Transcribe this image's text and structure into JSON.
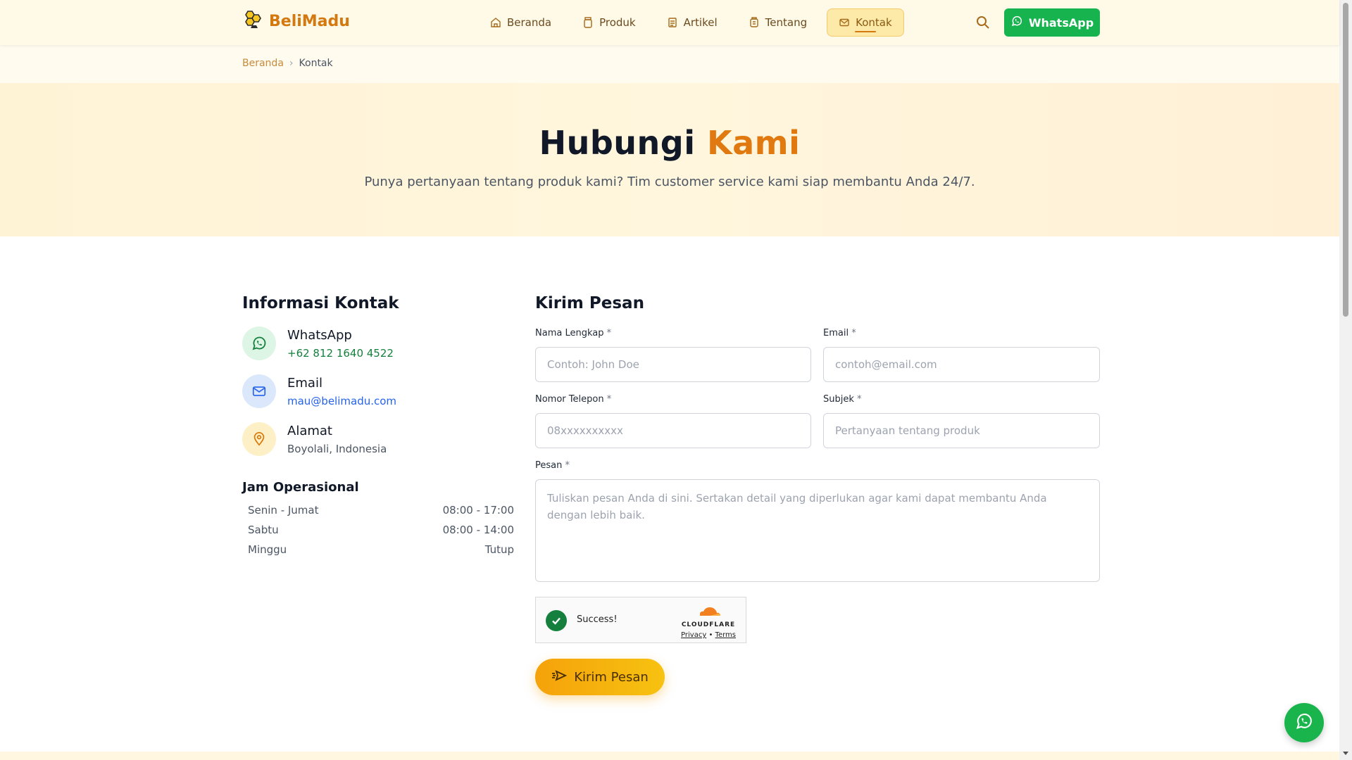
{
  "header": {
    "brand": "BeliMadu",
    "nav": [
      {
        "label": "Beranda",
        "icon": "home-icon"
      },
      {
        "label": "Produk",
        "icon": "jar-icon"
      },
      {
        "label": "Artikel",
        "icon": "article-icon"
      },
      {
        "label": "Tentang",
        "icon": "info-icon"
      },
      {
        "label": "Kontak",
        "icon": "mail-icon",
        "active": true
      }
    ],
    "whatsapp_label": "WhatsApp"
  },
  "breadcrumb": {
    "home": "Beranda",
    "separator": "›",
    "current": "Kontak"
  },
  "hero": {
    "title_main": "Hubungi",
    "title_accent": "Kami",
    "subtitle": "Punya pertanyaan tentang produk kami? Tim customer service kami siap membantu Anda 24/7."
  },
  "info": {
    "title": "Informasi Kontak",
    "items": [
      {
        "label": "WhatsApp",
        "value": "+62 812 1640 4522",
        "icon": "whatsapp-icon"
      },
      {
        "label": "Email",
        "value": "mau@belimadu.com",
        "icon": "mail-icon"
      },
      {
        "label": "Alamat",
        "value": "Boyolali, Indonesia",
        "icon": "location-pin-icon"
      }
    ],
    "hours_title": "Jam Operasional",
    "hours": [
      {
        "day": "Senin - Jumat",
        "time": "08:00 - 17:00"
      },
      {
        "day": "Sabtu",
        "time": "08:00 - 14:00"
      },
      {
        "day": "Minggu",
        "time": "Tutup"
      }
    ]
  },
  "form": {
    "title": "Kirim Pesan",
    "required_mark": "*",
    "name_label": "Nama Lengkap",
    "name_placeholder": "Contoh: John Doe",
    "email_label": "Email",
    "email_placeholder": "contoh@email.com",
    "phone_label": "Nomor Telepon",
    "phone_placeholder": "08xxxxxxxxxx",
    "subject_label": "Subjek",
    "subject_placeholder": "Pertanyaan tentang produk",
    "message_label": "Pesan",
    "message_placeholder": "Tuliskan pesan Anda di sini. Sertakan detail yang diperlukan agar kami dapat membantu Anda dengan lebih baik.",
    "captcha": {
      "status": "Success!",
      "brand": "CLOUDFLARE",
      "privacy": "Privacy",
      "dot": "•",
      "terms": "Terms"
    },
    "submit_label": "Kirim Pesan"
  },
  "colors": {
    "accent": "#e07a10",
    "whatsapp": "#16b34f",
    "link_green": "#15803d",
    "link_blue": "#2563eb"
  }
}
